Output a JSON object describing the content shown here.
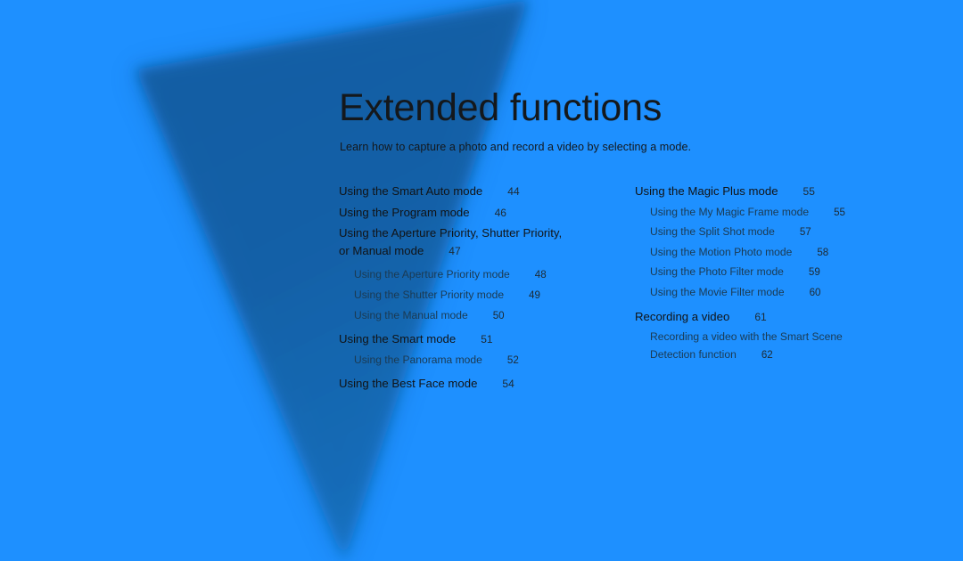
{
  "page": {
    "background_color": "#1e90ff",
    "accent_color": "#14181c",
    "title": "Extended functions",
    "subtitle": "Learn how to capture a photo and record a video by selecting a mode."
  },
  "toc": {
    "left_column": [
      {
        "label": "Using the Smart Auto mode",
        "page": "44",
        "level": 1
      },
      {
        "label": "Using the Program mode",
        "page": "46",
        "level": 1
      },
      {
        "label": "Using the Aperture Priority, Shutter Priority,",
        "label2": "or Manual mode",
        "page": "47",
        "level": 1
      },
      {
        "label": "Using the Aperture Priority mode",
        "page": "48",
        "level": 2
      },
      {
        "label": "Using the Shutter Priority mode",
        "page": "49",
        "level": 2
      },
      {
        "label": "Using the Manual mode",
        "page": "50",
        "level": 2
      },
      {
        "label": "Using the Smart mode",
        "page": "51",
        "level": 1
      },
      {
        "label": "Using the Panorama mode",
        "page": "52",
        "level": 2
      },
      {
        "label": "Using the Best Face mode",
        "page": "54",
        "level": 1
      }
    ],
    "right_column": [
      {
        "label": "Using the Magic Plus mode",
        "page": "55",
        "level": 1
      },
      {
        "label": "Using the My Magic Frame mode",
        "page": "55",
        "level": 2
      },
      {
        "label": "Using the Split Shot mode",
        "page": "57",
        "level": 2
      },
      {
        "label": "Using the Motion Photo mode",
        "page": "58",
        "level": 2
      },
      {
        "label": "Using the Photo Filter mode",
        "page": "59",
        "level": 2
      },
      {
        "label": "Using the Movie Filter mode",
        "page": "60",
        "level": 2
      },
      {
        "label": "Recording a video",
        "page": "61",
        "level": 1
      },
      {
        "label": "Recording a video with the Smart Scene",
        "label2": "Detection function",
        "page": "62",
        "level": 2
      }
    ]
  }
}
